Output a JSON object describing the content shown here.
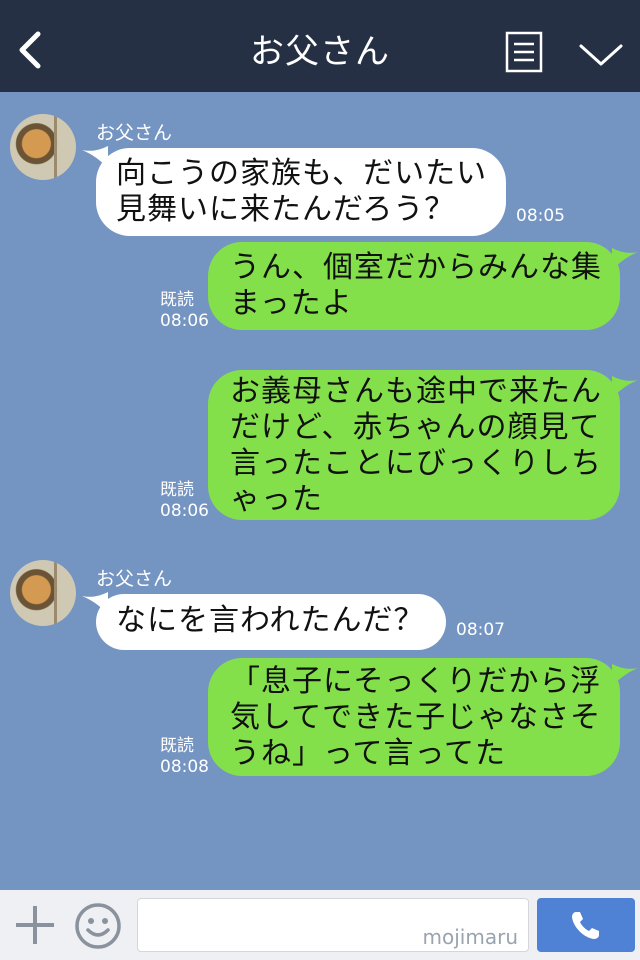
{
  "header": {
    "title": "お父さん",
    "back_icon": "chevron-left-icon",
    "menu_icon": "document-menu-icon",
    "expand_icon": "chevron-down-icon"
  },
  "messages": [
    {
      "direction": "incoming",
      "sender": "お父さん",
      "lines": [
        "向こうの家族も、だいたい",
        "見舞いに来たんだろう？"
      ],
      "time": "08:05"
    },
    {
      "direction": "outgoing",
      "read_label": "既読",
      "lines": [
        "うん、個室だからみんな集",
        "まったよ"
      ],
      "time": "08:06"
    },
    {
      "direction": "outgoing",
      "read_label": "既読",
      "lines": [
        "お義母さんも途中で来たん",
        "だけど、赤ちゃんの顔見て",
        "言ったことにびっくりしち",
        "ゃった"
      ],
      "time": "08:06"
    },
    {
      "direction": "incoming",
      "sender": "お父さん",
      "lines": [
        "なにを言われたんだ？"
      ],
      "time": "08:07"
    },
    {
      "direction": "outgoing",
      "read_label": "既読",
      "lines": [
        "「息子にそっくりだから浮",
        "気してできた子じゃなさそ",
        "うね」って言ってた"
      ],
      "time": "08:08"
    }
  ],
  "footer": {
    "input_value": "",
    "watermark": "mojimaru",
    "plus_icon": "plus-icon",
    "emoji_icon": "smile-icon",
    "call_icon": "phone-icon"
  },
  "colors": {
    "header_bg": "#263045",
    "chat_bg": "#7494c2",
    "outgoing_bubble": "#84e04a",
    "incoming_bubble": "#ffffff",
    "call_button": "#4f82d4"
  }
}
